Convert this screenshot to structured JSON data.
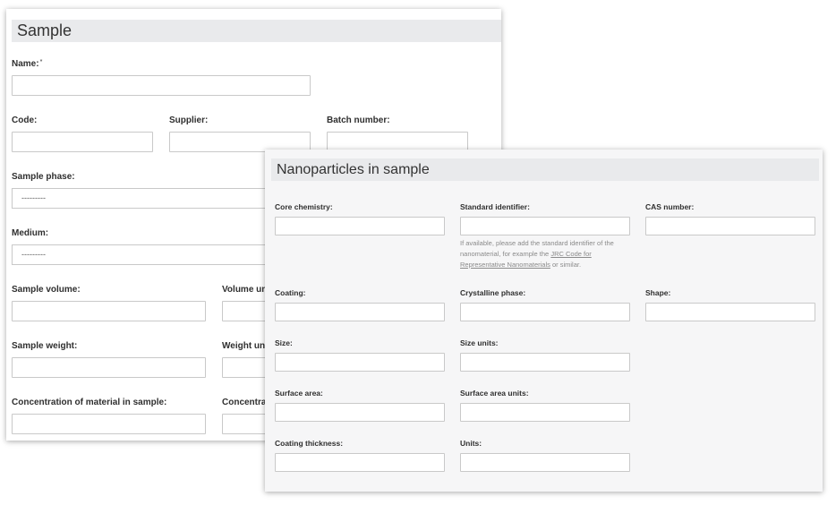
{
  "sample": {
    "title": "Sample",
    "name_label": "Name:",
    "name_required": "*",
    "code_label": "Code:",
    "supplier_label": "Supplier:",
    "batch_label": "Batch number:",
    "phase_label": "Sample phase:",
    "phase_value": "---------",
    "medium_label": "Medium:",
    "medium_value": "---------",
    "volume_label": "Sample volume:",
    "volume_units_label": "Volume un",
    "weight_label": "Sample weight:",
    "weight_units_label": "Weight uni",
    "concentration_label": "Concentration of material in sample:",
    "concentration_units_label": "Concentrat"
  },
  "nano": {
    "title": "Nanoparticles in sample",
    "core_label": "Core chemistry:",
    "standard_label": "Standard identifier:",
    "cas_label": "CAS number:",
    "help_line1": "If available, please add the standard identifier of the",
    "help_line2_pre": "nanomaterial, for example the ",
    "help_link1": "JRC Code for",
    "help_link2": "Representative Nanomaterials",
    "help_line3_post": " or similar.",
    "coating_label": "Coating:",
    "crystalline_label": "Crystalline phase:",
    "shape_label": "Shape:",
    "size_label": "Size:",
    "size_units_label": "Size units:",
    "surface_label": "Surface area:",
    "surface_units_label": "Surface area units:",
    "coating_thickness_label": "Coating thickness:",
    "units_label": "Units:"
  }
}
